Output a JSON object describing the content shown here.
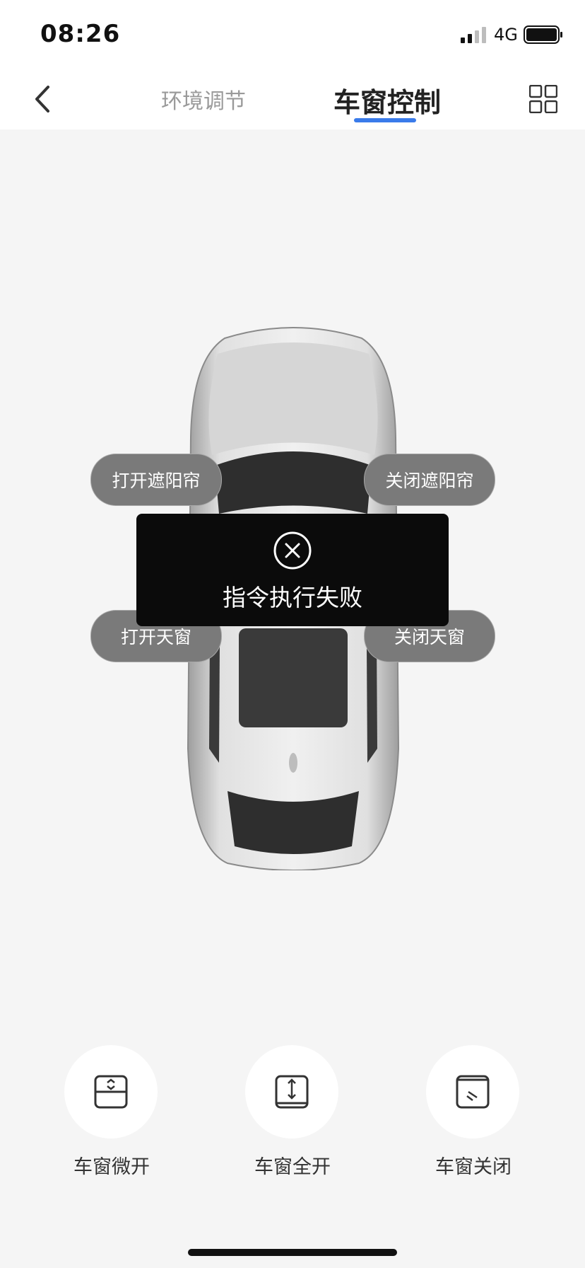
{
  "status_bar": {
    "time": "08:26",
    "network": "4G"
  },
  "header": {
    "tabs": [
      {
        "label": "环境调节"
      },
      {
        "label": "车窗控制"
      }
    ]
  },
  "controls": {
    "open_shade": "打开遮阳帘",
    "close_shade": "关闭遮阳帘",
    "open_sunroof": "打开天窗",
    "close_sunroof": "关闭天窗"
  },
  "toast": {
    "message": "指令执行失败"
  },
  "actions": [
    {
      "label": "车窗微开"
    },
    {
      "label": "车窗全开"
    },
    {
      "label": "车窗关闭"
    }
  ],
  "colors": {
    "accent": "#3a7bea",
    "background": "#f5f5f5",
    "toast_bg": "#0b0b0b"
  }
}
